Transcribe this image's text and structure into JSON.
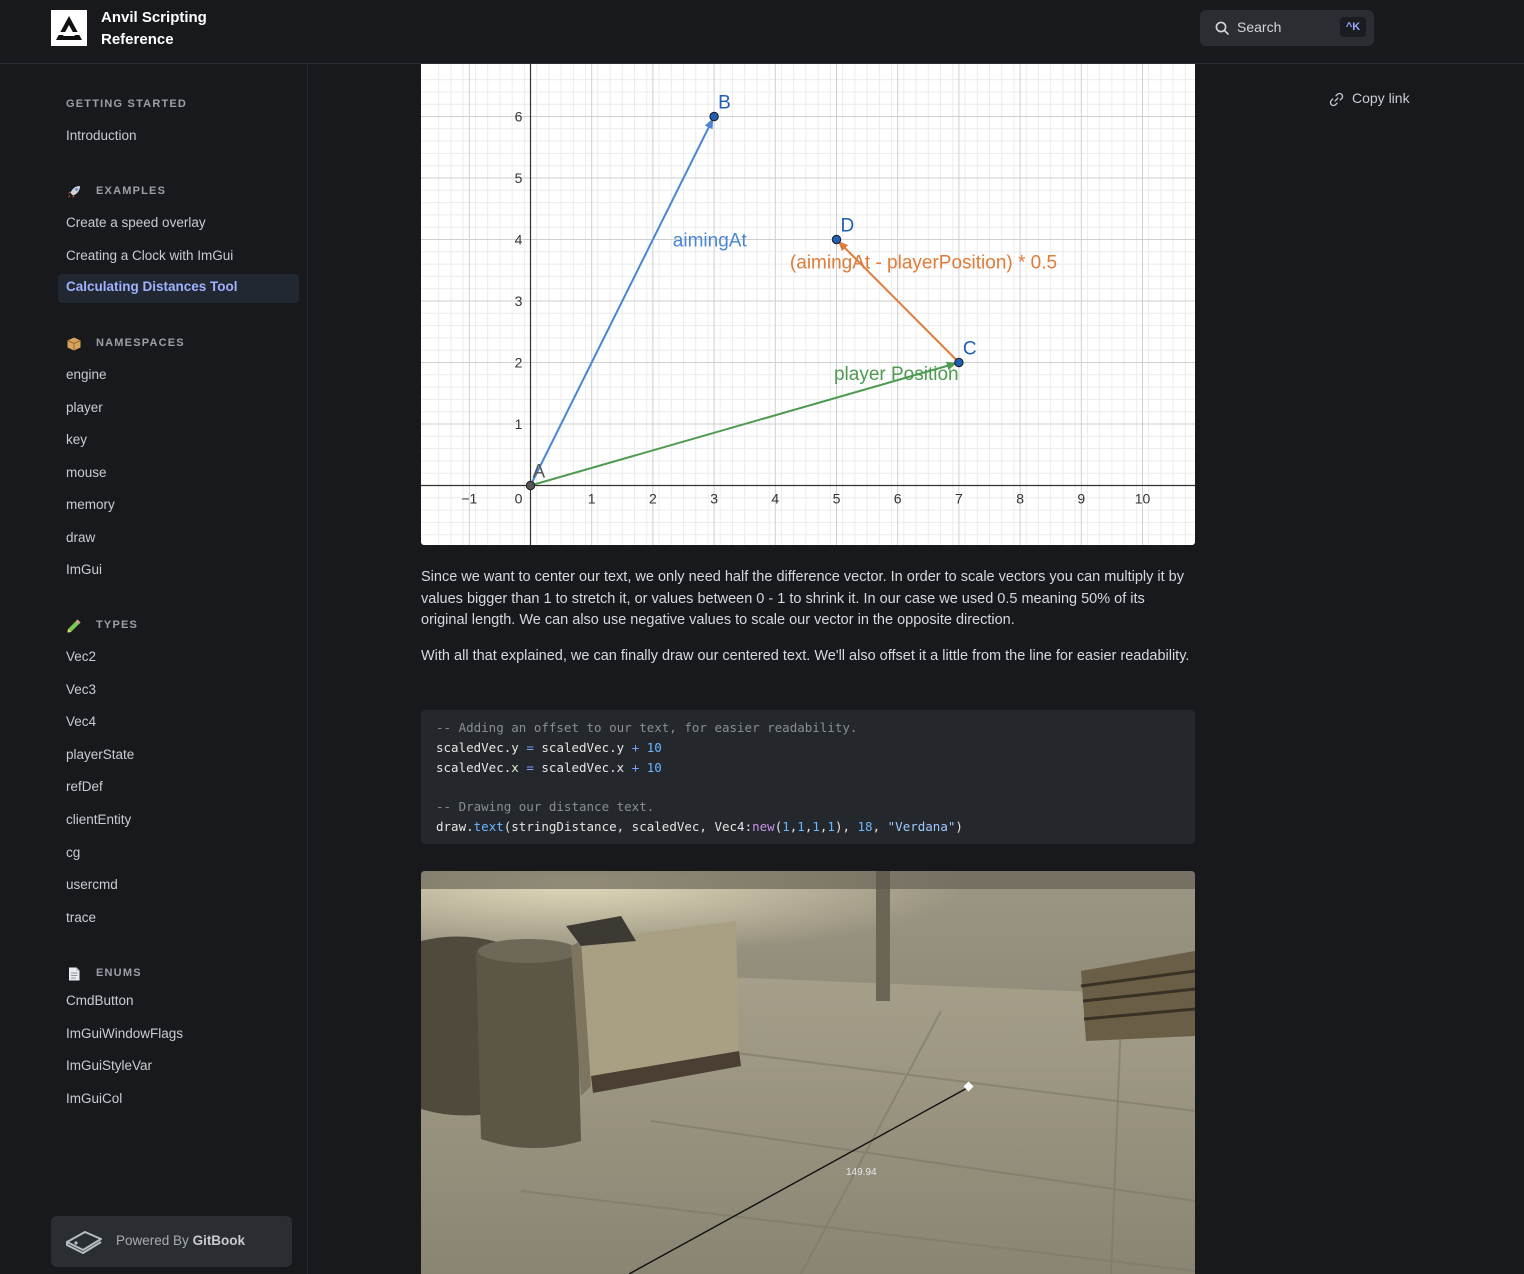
{
  "app": {
    "title": "Anvil Scripting Reference"
  },
  "search": {
    "label": "Search",
    "shortcut": "^K"
  },
  "sidebar": {
    "sections": [
      {
        "heading": "GETTING STARTED",
        "icon": "none",
        "items": [
          "Introduction"
        ]
      },
      {
        "heading": "EXAMPLES",
        "icon": "rocket-icon",
        "items": [
          "Create a speed overlay",
          "Creating a Clock with ImGui",
          "Calculating Distances Tool"
        ]
      },
      {
        "heading": "NAMESPACES",
        "icon": "package-icon",
        "items": [
          "engine",
          "player",
          "key",
          "mouse",
          "memory",
          "draw",
          "ImGui"
        ]
      },
      {
        "heading": "TYPES",
        "icon": "pencil-icon",
        "items": [
          "Vec2",
          "Vec3",
          "Vec4",
          "playerState",
          "refDef",
          "clientEntity",
          "cg",
          "usercmd",
          "trace"
        ]
      },
      {
        "heading": "ENUMS",
        "icon": "page-icon",
        "items": [
          "CmdButton",
          "ImGuiWindowFlags",
          "ImGuiStyleVar",
          "ImGuiCol"
        ]
      }
    ],
    "active_item": "Calculating Distances Tool",
    "footer": {
      "prefix": "Powered By",
      "brand": "GitBook"
    }
  },
  "page": {
    "copy_link": "Copy link",
    "paragraph1": "Since we want to center our text, we only need half the difference vector. In order to scale vectors you can multiply it by values bigger than 1 to stretch it, or values between 0 - 1 to shrink it. In our case we used 0.5 meaning 50% of its original length. We can also use negative values to scale our vector in the opposite direction.",
    "paragraph2": "With all that explained, we can finally draw our centered text. We'll also offset it a little from the line for easier readability.",
    "code": {
      "comment1": "-- Adding an offset to our text, for easier readability.",
      "line2_lhs": "scaledVec.y",
      "line2_rhs": "scaledVec.y",
      "line3_lhs": "scaledVec.x",
      "line3_rhs": "scaledVec.x",
      "eq": "=",
      "plus": "+",
      "offset": "10",
      "comment2": "-- Drawing our distance text.",
      "call_obj": "draw.",
      "call_fn": "text",
      "call_args1": "(stringDistance, scaledVec, Vec4:",
      "call_new": "new",
      "call_args2": "(",
      "one": "1",
      "comma": ",",
      "call_args3": "), ",
      "size": "18",
      "call_args4": ", ",
      "font_str": "\"Verdana\"",
      "call_end": ")"
    },
    "scene": {
      "distance_label": "149.94"
    }
  },
  "chart_data": {
    "type": "scatter",
    "title": "",
    "xlabel": "",
    "ylabel": "",
    "xlim": [
      -1.5,
      11
    ],
    "ylim": [
      -1,
      6.8
    ],
    "grid": true,
    "x_ticks": [
      "−1",
      "0",
      "1",
      "2",
      "3",
      "4",
      "5",
      "6",
      "7",
      "8",
      "9",
      "10"
    ],
    "x_tick_values": [
      -1,
      0,
      1,
      2,
      3,
      4,
      5,
      6,
      7,
      8,
      9,
      10
    ],
    "y_ticks": [
      "1",
      "2",
      "3",
      "4",
      "5",
      "6"
    ],
    "y_tick_values": [
      1,
      2,
      3,
      4,
      5,
      6
    ],
    "points": [
      {
        "label": "A",
        "x": 0,
        "y": 0
      },
      {
        "label": "B",
        "x": 3,
        "y": 6
      },
      {
        "label": "C",
        "x": 7,
        "y": 2
      },
      {
        "label": "D",
        "x": 5,
        "y": 4
      }
    ],
    "vectors": [
      {
        "label": "aimingAt",
        "from": [
          0,
          0
        ],
        "to": [
          3,
          6
        ],
        "color": "#4a86d4"
      },
      {
        "label": "player Position",
        "from": [
          0,
          0
        ],
        "to": [
          7,
          2
        ],
        "color": "#4e9a50"
      },
      {
        "label": "(aimingAt - playerPosition) * 0.5",
        "from": [
          7,
          2
        ],
        "to": [
          5,
          4
        ],
        "color": "#e07b39"
      }
    ]
  },
  "colors": {
    "accent": "#9fb1ff",
    "background": "#17191c",
    "code_bg": "#24272b"
  }
}
